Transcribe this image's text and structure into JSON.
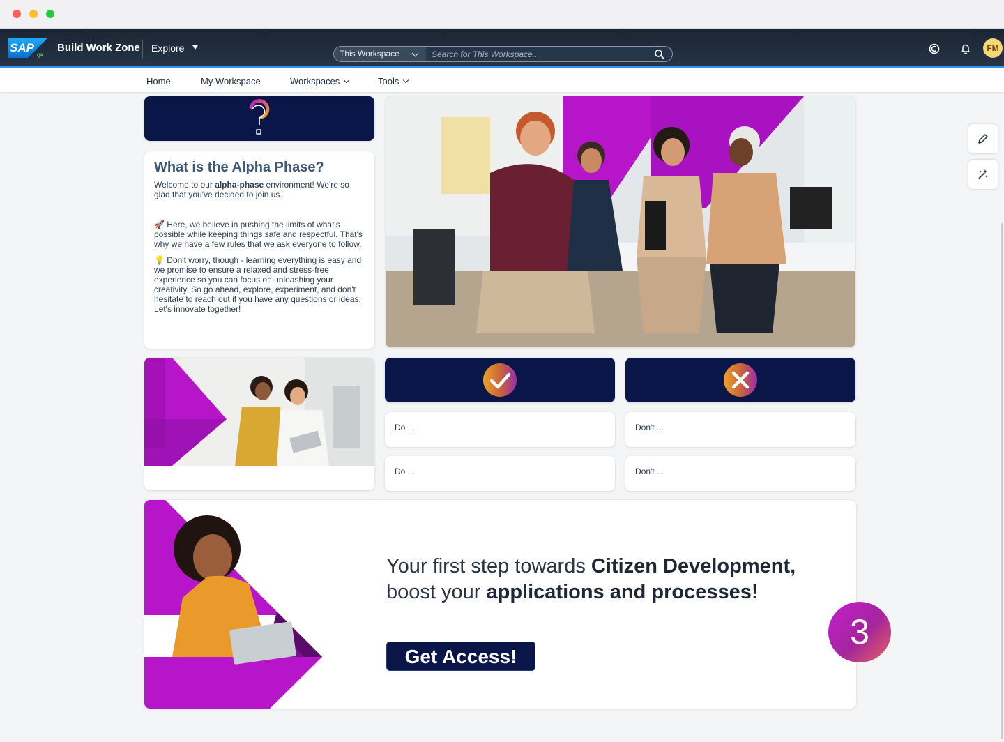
{
  "shell": {
    "logo_text": "SAP",
    "logo_badge": "QA",
    "brand": "Build Work Zone",
    "explore_label": "Explore",
    "search_scope": "This Workspace",
    "search_placeholder": "Search for This Workspace...",
    "avatar_initials": "FM"
  },
  "nav": {
    "items": [
      {
        "label": "Home"
      },
      {
        "label": "My Workspace"
      },
      {
        "label": "Workspaces"
      },
      {
        "label": "Tools"
      }
    ]
  },
  "intro": {
    "title": "What is the Alpha Phase?",
    "p1_before": "Welcome to our ",
    "p1_bold": "alpha-phase",
    "p1_after": " environment! We're so glad that you've decided to join us.",
    "p2": "🚀 Here, we believe in pushing the limits of what's possible while keeping things safe and respectful. That's why we have a few rules that we ask everyone to follow.",
    "p3": "💡 Don't worry, though - learning everything is easy and we promise to ensure a relaxed and stress-free experience so you can focus on unleashing your creativity. So go ahead, explore, experiment, and don't hesitate to reach out if you have any questions or ideas. Let's innovate together!"
  },
  "rules": {
    "do": [
      "Do ...",
      "Do ..."
    ],
    "dont": [
      "Don't ...",
      "Don't ..."
    ]
  },
  "banner": {
    "line1_light": "Your first step towards ",
    "line1_bold": "Citizen Development,",
    "line2_light": "boost your ",
    "line2_bold": "applications and processes!",
    "cta": "Get Access!"
  },
  "step_badge": "3",
  "colors": {
    "accent_magenta": "#b418c8",
    "navy": "#0a1648",
    "shell_underline": "#2f95f5"
  }
}
